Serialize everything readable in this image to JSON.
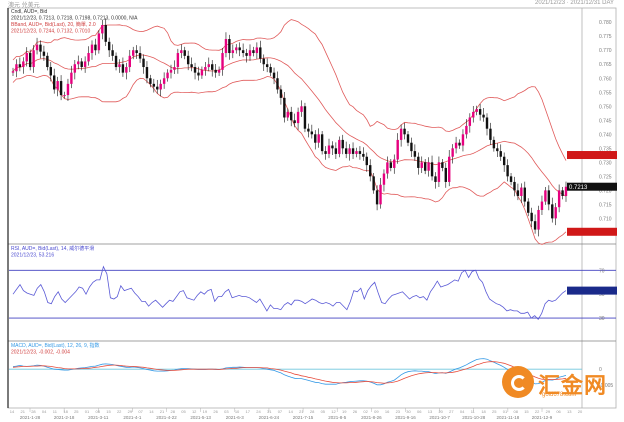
{
  "header": {
    "left": "澳元 兑美元",
    "right": "2021/12/23 · 2021/12/31 DAY"
  },
  "chart_data": [
    {
      "type": "candlestick",
      "legend": [
        "Cndl, AUD=, Bid",
        "2021/12/23, 0.7213, 0.7218, 0.7198, 0.7213, 0.0000, N/A",
        "BBand, AUD=, Bid(Last), 20, 簡單, 2.0",
        "2021/12/23, 0.7244, 0.7132, 0.7010"
      ],
      "y_ticks": [
        0.78,
        0.775,
        0.77,
        0.765,
        0.76,
        0.755,
        0.75,
        0.745,
        0.74,
        0.735,
        0.73,
        0.725,
        0.72,
        0.715,
        0.71,
        0.705
      ],
      "ylim": [
        0.703,
        0.7815
      ],
      "close": [
        0.7625,
        0.765,
        0.764,
        0.766,
        0.769,
        0.764,
        0.77,
        0.772,
        0.7695,
        0.768,
        0.764,
        0.761,
        0.756,
        0.759,
        0.754,
        0.754,
        0.758,
        0.762,
        0.765,
        0.766,
        0.764,
        0.766,
        0.769,
        0.772,
        0.77,
        0.776,
        0.779,
        0.773,
        0.77,
        0.768,
        0.764,
        0.765,
        0.762,
        0.764,
        0.768,
        0.77,
        0.769,
        0.767,
        0.764,
        0.76,
        0.758,
        0.757,
        0.756,
        0.758,
        0.76,
        0.762,
        0.763,
        0.764,
        0.769,
        0.77,
        0.768,
        0.765,
        0.764,
        0.762,
        0.761,
        0.763,
        0.764,
        0.765,
        0.763,
        0.762,
        0.763,
        0.769,
        0.774,
        0.769,
        0.77,
        0.771,
        0.77,
        0.769,
        0.768,
        0.77,
        0.769,
        0.771,
        0.767,
        0.765,
        0.764,
        0.762,
        0.76,
        0.756,
        0.753,
        0.746,
        0.748,
        0.745,
        0.744,
        0.748,
        0.75,
        0.742,
        0.741,
        0.74,
        0.737,
        0.74,
        0.734,
        0.733,
        0.736,
        0.735,
        0.733,
        0.738,
        0.735,
        0.733,
        0.735,
        0.733,
        0.734,
        0.733,
        0.732,
        0.729,
        0.725,
        0.72,
        0.715,
        0.722,
        0.726,
        0.73,
        0.728,
        0.731,
        0.738,
        0.742,
        0.74,
        0.737,
        0.734,
        0.732,
        0.728,
        0.73,
        0.727,
        0.73,
        0.725,
        0.723,
        0.73,
        0.728,
        0.723,
        0.732,
        0.735,
        0.737,
        0.736,
        0.74,
        0.743,
        0.746,
        0.748,
        0.749,
        0.747,
        0.746,
        0.742,
        0.738,
        0.735,
        0.734,
        0.732,
        0.729,
        0.725,
        0.723,
        0.72,
        0.718,
        0.721,
        0.716,
        0.712,
        0.709,
        0.706,
        0.713,
        0.716,
        0.72,
        0.715,
        0.71,
        0.714,
        0.72,
        0.718,
        0.7213
      ],
      "current_price": 0.7213,
      "price_tags": [
        {
          "label": "0.7213",
          "value": 0.7213
        }
      ]
    },
    {
      "type": "line",
      "legend": [
        "RSI, AUD=, Bid(Last), 14, 威尔德平滑",
        "2021/12/23, 53.216"
      ],
      "y_ticks": [
        70,
        50,
        30
      ],
      "ylim": [
        20,
        82
      ],
      "reference_lines": [
        70,
        30
      ],
      "series": [
        {
          "color": "#5a5ad6",
          "values": [
            50,
            54,
            58,
            53,
            51,
            50,
            49,
            55,
            58,
            52,
            43,
            42,
            48,
            52,
            46,
            43,
            46,
            49,
            52,
            56,
            55,
            50,
            56,
            60,
            62,
            62,
            73,
            67,
            47,
            46,
            48,
            57,
            53,
            54,
            55,
            51,
            48,
            44,
            44,
            40,
            43,
            45,
            42,
            39,
            42,
            45,
            44,
            48,
            52,
            53,
            47,
            46,
            45,
            49,
            52,
            50,
            53,
            54,
            44,
            48,
            48,
            52,
            54,
            47,
            48,
            49,
            48,
            48,
            47,
            45,
            43,
            46,
            41,
            36,
            41,
            38,
            38,
            37,
            41,
            43,
            41,
            45,
            45,
            44,
            42,
            44,
            46,
            45,
            43,
            42,
            43,
            42,
            40,
            43,
            43,
            40,
            37,
            44,
            53,
            52,
            55,
            46,
            53,
            57,
            60,
            51,
            43,
            42,
            46,
            49,
            50,
            51,
            52,
            49,
            46,
            48,
            49,
            47,
            48,
            45,
            52,
            56,
            61,
            56,
            57,
            58,
            60,
            62,
            61,
            68,
            70,
            64,
            69,
            70,
            63,
            60,
            52,
            46,
            44,
            42,
            41,
            39,
            36,
            37,
            36,
            36,
            34,
            34,
            35,
            30,
            32,
            29,
            34,
            42,
            45,
            44,
            45,
            48,
            51,
            53
          ]
        }
      ]
    },
    {
      "type": "line",
      "legend": [
        "MACD, AUD=, Bid(Last), 12, 26, 9, 指数",
        "2021/12/23, -0.002, -0.004"
      ],
      "y_ticks": [
        0,
        -0.005
      ],
      "ylim": [
        -0.0105,
        0.0055
      ],
      "reference_lines": [
        0
      ],
      "series": [
        {
          "color": "#3399e6",
          "values": [
            0.0008,
            0.001,
            0.0012,
            0.001,
            0.0009,
            0.001,
            0.0011,
            0.0013,
            0.0012,
            0.001,
            0.0006,
            0.0003,
            0.0,
            -0.0001,
            -0.0002,
            -0.0003,
            -0.0003,
            -0.0001,
            0.0001,
            0.0003,
            0.0004,
            0.0005,
            0.0007,
            0.0009,
            0.001,
            0.0013,
            0.0016,
            0.0017,
            0.0016,
            0.0015,
            0.0012,
            0.001,
            0.0008,
            0.0006,
            0.0006,
            0.0007,
            0.0006,
            0.0004,
            0.0002,
            -0.0001,
            -0.0003,
            -0.0005,
            -0.0006,
            -0.0006,
            -0.0006,
            -0.0005,
            -0.0004,
            -0.0003,
            0.0,
            0.0002,
            0.0002,
            0.0002,
            0.0001,
            0.0,
            -0.0001,
            -0.0001,
            -0.0001,
            0.0,
            0.0,
            -0.0001,
            -0.0001,
            0.0001,
            0.0004,
            0.0005,
            0.0006,
            0.0006,
            0.0007,
            0.0006,
            0.0005,
            0.0005,
            0.0005,
            0.0005,
            0.0004,
            0.0002,
            0.0,
            -0.0002,
            -0.0004,
            -0.0008,
            -0.0012,
            -0.0018,
            -0.0022,
            -0.0026,
            -0.0029,
            -0.003,
            -0.003,
            -0.0033,
            -0.0036,
            -0.0039,
            -0.0042,
            -0.0043,
            -0.0046,
            -0.0048,
            -0.0048,
            -0.0048,
            -0.0048,
            -0.0045,
            -0.0043,
            -0.0042,
            -0.004,
            -0.0039,
            -0.0038,
            -0.0037,
            -0.0037,
            -0.0038,
            -0.0041,
            -0.0045,
            -0.005,
            -0.005,
            -0.0047,
            -0.0042,
            -0.0039,
            -0.0035,
            -0.0027,
            -0.0018,
            -0.0012,
            -0.0008,
            -0.0006,
            -0.0005,
            -0.0006,
            -0.0006,
            -0.0008,
            -0.0008,
            -0.0011,
            -0.0014,
            -0.0012,
            -0.0011,
            -0.0013,
            -0.0009,
            -0.0004,
            0.0001,
            0.0004,
            0.0009,
            0.0014,
            0.002,
            0.0026,
            0.0031,
            0.0033,
            0.0034,
            0.0032,
            0.0027,
            0.0022,
            0.0017,
            0.0012,
            0.0006,
            -0.0001,
            -0.0007,
            -0.0014,
            -0.002,
            -0.0023,
            -0.0028,
            -0.0034,
            -0.004,
            -0.0047,
            -0.0046,
            -0.0042,
            -0.0036,
            -0.0034,
            -0.0035,
            -0.0032,
            -0.0026,
            -0.0023,
            -0.002
          ]
        },
        {
          "color": "#e74c3c",
          "values": [
            0.0006,
            0.0007,
            0.0008,
            0.0009,
            0.0009,
            0.0009,
            0.001,
            0.001,
            0.0011,
            0.0011,
            0.001,
            0.0009,
            0.0007,
            0.0005,
            0.0004,
            0.0002,
            0.0001,
            0.0001,
            0.0001,
            0.0001,
            0.0002,
            0.0003,
            0.0003,
            0.0004,
            0.0006,
            0.0007,
            0.0009,
            0.0011,
            0.0012,
            0.0013,
            0.0013,
            0.0012,
            0.0011,
            0.001,
            0.0009,
            0.0009,
            0.0008,
            0.0007,
            0.0006,
            0.0004,
            0.0003,
            0.0001,
            -0.0001,
            -0.0002,
            -0.0003,
            -0.0004,
            -0.0004,
            -0.0004,
            -0.0003,
            -0.0002,
            -0.0001,
            0.0,
            0.0,
            0.0,
            0.0,
            0.0,
            -0.0,
            -0.0,
            -0.0,
            -0.0,
            -0.0001,
            0.0,
            0.0001,
            0.0002,
            0.0003,
            0.0003,
            0.0004,
            0.0005,
            0.0005,
            0.0005,
            0.0005,
            0.0005,
            0.0005,
            0.0004,
            0.0004,
            0.0002,
            0.0001,
            -0.0001,
            -0.0003,
            -0.0006,
            -0.0009,
            -0.0012,
            -0.0016,
            -0.0018,
            -0.0021,
            -0.0023,
            -0.0026,
            -0.0028,
            -0.0031,
            -0.0033,
            -0.0036,
            -0.0038,
            -0.004,
            -0.0042,
            -0.0043,
            -0.0044,
            -0.0044,
            -0.0044,
            -0.0043,
            -0.0043,
            -0.0042,
            -0.0041,
            -0.004,
            -0.0039,
            -0.004,
            -0.0041,
            -0.0043,
            -0.0044,
            -0.0045,
            -0.0044,
            -0.0043,
            -0.0041,
            -0.0038,
            -0.0034,
            -0.0029,
            -0.0025,
            -0.0021,
            -0.0018,
            -0.0015,
            -0.0013,
            -0.0012,
            -0.0011,
            -0.0011,
            -0.0011,
            -0.0012,
            -0.0012,
            -0.0012,
            -0.0011,
            -0.001,
            -0.0008,
            -0.0005,
            -0.0002,
            0.0001,
            0.0005,
            0.0009,
            0.0014,
            0.0017,
            0.0021,
            0.0023,
            0.0024,
            0.0024,
            0.0023,
            0.0021,
            0.0019,
            0.0015,
            0.0011,
            0.0006,
            0.0001,
            -0.0004,
            -0.0009,
            -0.0014,
            -0.002,
            -0.0025,
            -0.0029,
            -0.0032,
            -0.0033,
            -0.0033,
            -0.0033,
            -0.0033,
            -0.0032,
            -0.0031,
            -0.0029
          ]
        }
      ]
    }
  ],
  "x_axis": {
    "date_labels": [
      "2021-1-28",
      "2021-2-18",
      "2021-3-11",
      "2021-4-1",
      "2021-4-22",
      "2021-5-13",
      "2021-6-3",
      "2021-6-24",
      "2021-7-15",
      "2021-8-5",
      "2021-8-26",
      "2021-9-16",
      "2021-10-7",
      "2021-10-28",
      "2021-11-18",
      "2021-12-9"
    ],
    "day_labels": [
      "14",
      "21",
      "28",
      "04",
      "11",
      "18",
      "25",
      "01",
      "08",
      "15",
      "22",
      "29",
      "07",
      "14",
      "21",
      "28",
      "05",
      "12",
      "19",
      "26",
      "03",
      "10",
      "17",
      "24",
      "31",
      "07",
      "14",
      "21",
      "28",
      "05",
      "12",
      "19",
      "26",
      "02",
      "09",
      "16",
      "23",
      "30",
      "06",
      "13",
      "20",
      "27",
      "04",
      "11",
      "18",
      "25",
      "01",
      "08",
      "15",
      "22",
      "29",
      "06",
      "13",
      "20"
    ]
  },
  "logo": {
    "brand": "汇金网",
    "url": "gold678.com"
  }
}
